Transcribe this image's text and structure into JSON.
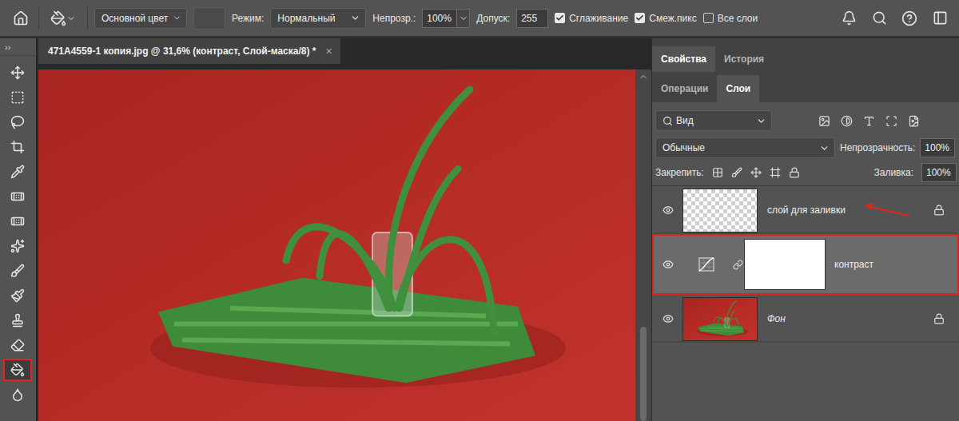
{
  "options_bar": {
    "fill_source": "Основной цвет",
    "mode_label": "Режим:",
    "mode_value": "Нормальный",
    "opacity_label": "Непрозр.:",
    "opacity_value": "100%",
    "tolerance_label": "Допуск:",
    "tolerance_value": "255",
    "checkboxes": [
      {
        "label": "Сглаживание",
        "checked": true
      },
      {
        "label": "Смеж.пикс",
        "checked": true
      },
      {
        "label": "Все слои",
        "checked": false
      }
    ]
  },
  "toolbar": {
    "collapse": "››",
    "tools": [
      {
        "kind": "move",
        "selected": false,
        "highlighted": false
      },
      {
        "kind": "marquee",
        "selected": false,
        "highlighted": false
      },
      {
        "kind": "lasso",
        "selected": false,
        "highlighted": false
      },
      {
        "kind": "crop",
        "selected": false,
        "highlighted": false
      },
      {
        "kind": "eyedropper",
        "selected": false,
        "highlighted": false
      },
      {
        "kind": "healing",
        "selected": false,
        "highlighted": false
      },
      {
        "kind": "spot-healing",
        "selected": false,
        "highlighted": false
      },
      {
        "kind": "patch",
        "selected": false,
        "highlighted": false
      },
      {
        "kind": "brush",
        "selected": false,
        "highlighted": false
      },
      {
        "kind": "mixer-brush",
        "selected": false,
        "highlighted": false
      },
      {
        "kind": "stamp",
        "selected": false,
        "highlighted": false
      },
      {
        "kind": "eraser",
        "selected": false,
        "highlighted": false
      },
      {
        "kind": "bucket",
        "selected": true,
        "highlighted": true
      },
      {
        "kind": "smudge",
        "selected": false,
        "highlighted": false
      }
    ]
  },
  "document": {
    "tab_title": "471A4559-1 копия.jpg @ 31,6% (контраст, Слой-маска/8) *",
    "close": "×",
    "scrollbar": {
      "offset": 0.72,
      "size": 0.28
    }
  },
  "panel": {
    "tabs": [
      {
        "label": "Свойства",
        "selected": true
      },
      {
        "label": "История",
        "selected": false
      }
    ],
    "subtabs": [
      {
        "label": "Операции",
        "selected": false
      },
      {
        "label": "Слои",
        "selected": true
      }
    ],
    "filter": "Вид",
    "blend_mode": "Обычные",
    "opacity_label": "Непрозрачность:",
    "opacity_value": "100%",
    "lock_label": "Закрепить:",
    "fill_label": "Заливка:",
    "fill_value": "100%",
    "layers": [
      {
        "name": "слой для заливки",
        "kind": "transparent",
        "visible": true,
        "locked": true,
        "selected": false,
        "highlighted": false,
        "arrow": true,
        "italic": false
      },
      {
        "name": "контраст",
        "kind": "adjustment",
        "visible": true,
        "locked": false,
        "selected": true,
        "highlighted": true,
        "arrow": false,
        "italic": false
      },
      {
        "name": "Фон",
        "kind": "photo",
        "visible": true,
        "locked": true,
        "selected": false,
        "highlighted": false,
        "arrow": false,
        "italic": true
      }
    ]
  }
}
